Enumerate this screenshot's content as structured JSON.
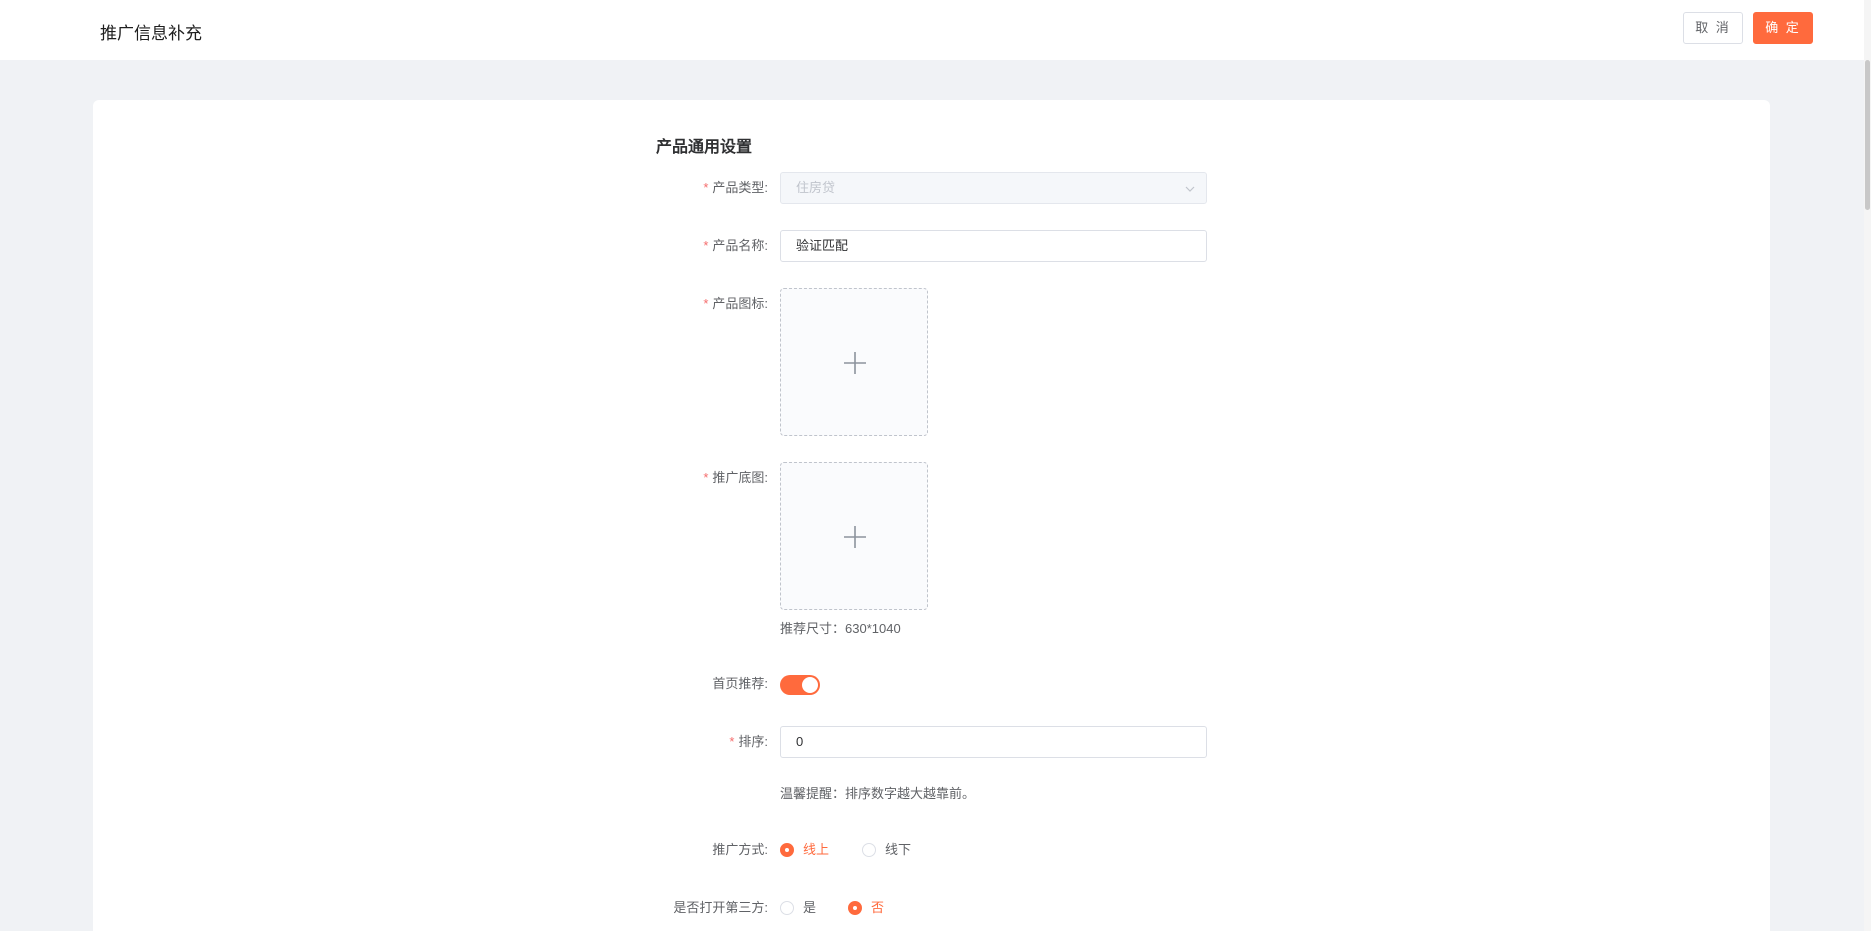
{
  "header": {
    "title": "推广信息补充",
    "cancel_label": "取 消",
    "ok_label": "确 定"
  },
  "colors": {
    "accent": "#ff6a3d",
    "required": "#f56c6c",
    "background": "#f0f2f5"
  },
  "form": {
    "section_title": "产品通用设置",
    "product_type": {
      "label": "产品类型:",
      "value": "住房贷",
      "disabled": true
    },
    "product_name": {
      "label": "产品名称:",
      "value": "验证匹配"
    },
    "product_icon": {
      "label": "产品图标:",
      "icon": "plus-icon"
    },
    "promo_image": {
      "label": "推广底图:",
      "icon": "plus-icon",
      "hint": "推荐尺寸：630*1040"
    },
    "home_recommend": {
      "label": "首页推荐:",
      "enabled": true
    },
    "sort": {
      "label": "排序:",
      "value": "0",
      "hint": "温馨提醒：排序数字越大越靠前。"
    },
    "promo_method": {
      "label": "推广方式:",
      "options": [
        "线上",
        "线下"
      ],
      "selected": "线上"
    },
    "open_third_party": {
      "label": "是否打开第三方:",
      "options": [
        "是",
        "否"
      ],
      "selected": "否"
    }
  }
}
